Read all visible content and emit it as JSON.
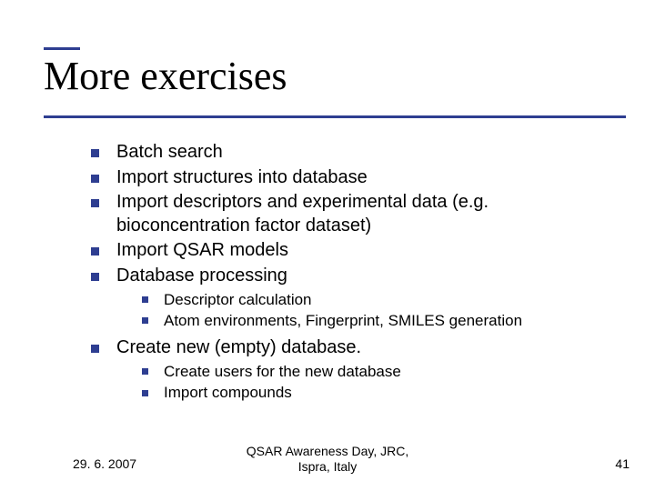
{
  "title": "More exercises",
  "bullets": {
    "b0": "Batch search",
    "b1": "Import structures into database",
    "b2": "Import descriptors and experimental data (e.g. bioconcentration factor dataset)",
    "b3": "Import QSAR models",
    "b4": "Database processing",
    "b4s0": "Descriptor calculation",
    "b4s1": "Atom environments, Fingerprint, SMILES generation",
    "b5": "Create new (empty) database.",
    "b5s0": "Create users for the new database",
    "b5s1": "Import compounds"
  },
  "footer": {
    "date": "29. 6. 2007",
    "center_line1": "QSAR Awareness Day, JRC,",
    "center_line2": "Ispra, Italy",
    "page": "41"
  }
}
